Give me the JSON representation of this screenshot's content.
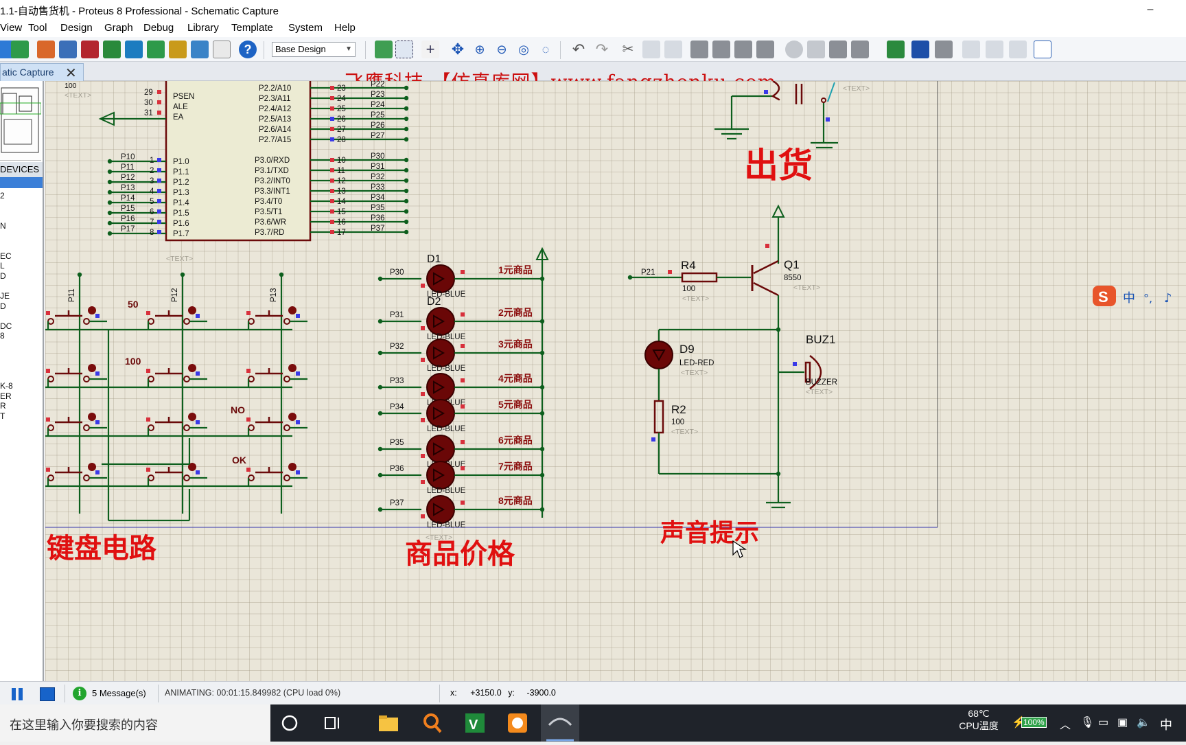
{
  "titlebar": {
    "title": "1.1-自动售货机 - Proteus 8 Professional - Schematic Capture",
    "minimize": "–"
  },
  "menubar": {
    "items": [
      "View",
      "Tool",
      "Design",
      "Graph",
      "Debug",
      "Library",
      "Template",
      "System",
      "Help"
    ]
  },
  "toolbar": {
    "design_select": "Base Design"
  },
  "tab": {
    "label": "atic Capture",
    "close": "✕"
  },
  "watermark": "飞鹰科技-【仿真库网】www.fangzhenku.com",
  "sidebar": {
    "devices_header": "DEVICES",
    "device_items": [
      "2",
      "",
      "",
      "N",
      "",
      "",
      "EC",
      "L",
      "D",
      "",
      "JE",
      "D",
      "",
      "DC",
      "8",
      "",
      "",
      "",
      "",
      "K-8",
      "ER",
      "R",
      "T"
    ]
  },
  "schematic": {
    "mcu": {
      "top_pin_numbers": [
        "29",
        "30",
        "31"
      ],
      "top_pin_labels": [
        "PSEN",
        "ALE",
        "EA"
      ],
      "left_pins": [
        {
          "net": "P10",
          "num": "1",
          "label": "P1.0"
        },
        {
          "net": "P11",
          "num": "2",
          "label": "P1.1"
        },
        {
          "net": "P12",
          "num": "3",
          "label": "P1.2"
        },
        {
          "net": "P13",
          "num": "4",
          "label": "P1.3"
        },
        {
          "net": "P14",
          "num": "5",
          "label": "P1.4"
        },
        {
          "net": "P15",
          "num": "6",
          "label": "P1.5"
        },
        {
          "net": "P16",
          "num": "7",
          "label": "P1.6"
        },
        {
          "net": "P17",
          "num": "8",
          "label": "P1.7"
        }
      ],
      "right_pins_p2": [
        {
          "label": "P2.2/A10",
          "num": "23",
          "net": "P22"
        },
        {
          "label": "P2.3/A11",
          "num": "24",
          "net": "P23"
        },
        {
          "label": "P2.4/A12",
          "num": "25",
          "net": "P24"
        },
        {
          "label": "P2.5/A13",
          "num": "26",
          "net": "P25"
        },
        {
          "label": "P2.6/A14",
          "num": "27",
          "net": "P26"
        },
        {
          "label": "P2.7/A15",
          "num": "28",
          "net": "P27"
        }
      ],
      "right_pins_p3": [
        {
          "label": "P3.0/RXD",
          "num": "10",
          "net": "P30"
        },
        {
          "label": "P3.1/TXD",
          "num": "11",
          "net": "P31"
        },
        {
          "label": "P3.2/INT0",
          "num": "12",
          "net": "P32"
        },
        {
          "label": "P3.3/INT1",
          "num": "13",
          "net": "P33"
        },
        {
          "label": "P3.4/T0",
          "num": "14",
          "net": "P34"
        },
        {
          "label": "P3.5/T1",
          "num": "15",
          "net": "P35"
        },
        {
          "label": "P3.6/WR",
          "num": "16",
          "net": "P36"
        },
        {
          "label": "P3.7/RD",
          "num": "17",
          "net": "P37"
        }
      ],
      "text_placeholder": "<TEXT>",
      "top_value": "100"
    },
    "keyboard": {
      "col_nets": [
        "P11",
        "P12",
        "P13"
      ],
      "key_labels": [
        "50",
        "100",
        "NO",
        "OK"
      ],
      "section_title": "键盘电路"
    },
    "leds": {
      "items": [
        {
          "ref": "D1",
          "net": "P30",
          "price": "1元商品",
          "type": "LED-BLUE"
        },
        {
          "ref": "D2",
          "net": "P31",
          "price": "2元商品",
          "type": "LED-BLUE"
        },
        {
          "ref": "",
          "net": "P32",
          "price": "3元商品",
          "type": "LED-BLUE"
        },
        {
          "ref": "",
          "net": "P33",
          "price": "4元商品",
          "type": "LED-BLUE"
        },
        {
          "ref": "",
          "net": "P34",
          "price": "5元商品",
          "type": "LED-BLUE"
        },
        {
          "ref": "",
          "net": "P35",
          "price": "6元商品",
          "type": "LED-BLUE"
        },
        {
          "ref": "",
          "net": "P36",
          "price": "7元商品",
          "type": "LED-BLUE"
        },
        {
          "ref": "",
          "net": "P37",
          "price": "8元商品",
          "type": "LED-BLUE"
        }
      ],
      "section_title": "商品价格"
    },
    "delivery": {
      "title": "出货",
      "text": "<TEXT>"
    },
    "sound": {
      "r4_ref": "R4",
      "r4_value": "100",
      "net": "P21",
      "q1_ref": "Q1",
      "q1_value": "8550",
      "d9_ref": "D9",
      "d9_type": "LED-RED",
      "r2_ref": "R2",
      "r2_value": "100",
      "buz_ref": "BUZ1",
      "buz_type": "BUZZER",
      "section_title": "声音提示"
    }
  },
  "statusbar": {
    "messages": "5 Message(s)",
    "msg_icon": "i",
    "animating": "ANIMATING: 00:01:15.849982 (CPU load 0%)",
    "x_label": "x:",
    "x_value": "+3150.0",
    "y_label": "y:",
    "y_value": "-3900.0"
  },
  "taskbar": {
    "search_placeholder": "在这里输入你要搜索的内容",
    "temp": "68℃",
    "temp_label": "CPU温度",
    "battery": "100%",
    "ime": "中"
  },
  "colors": {
    "wire": "#0d5f1d",
    "pin_red": "#d8303c",
    "pin_blue": "#3a3ae8",
    "component": "#6b0a0a",
    "title_red": "#e01010",
    "body_fill": "#ecebd3"
  }
}
